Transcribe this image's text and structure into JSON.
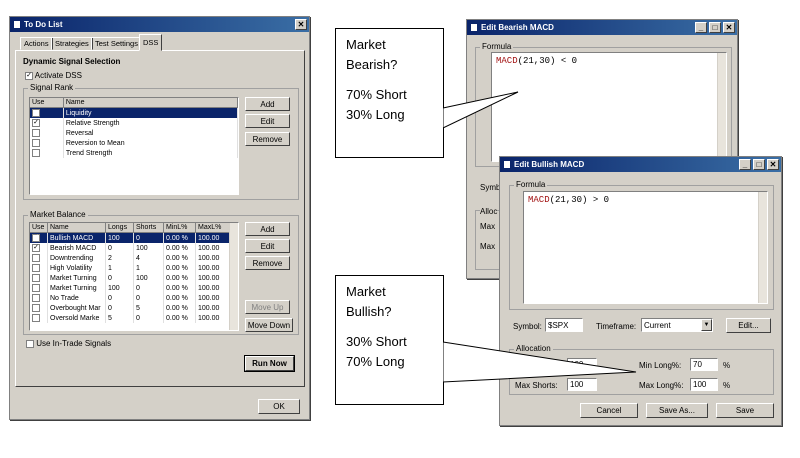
{
  "todo": {
    "title": "To Do List",
    "close_glyph": "✕",
    "tabs": [
      "Actions",
      "Strategies",
      "Test Settings",
      "DSS"
    ],
    "section_title": "Dynamic Signal Selection",
    "activate_label": "Activate DSS",
    "signal_rank": {
      "label": "Signal Rank",
      "headers": [
        "Use",
        "Name"
      ],
      "rows": [
        {
          "checked": false,
          "name": "Liquidity",
          "selected": true
        },
        {
          "checked": true,
          "name": "Relative Strength",
          "selected": false
        },
        {
          "checked": false,
          "name": "Reversal",
          "selected": false
        },
        {
          "checked": false,
          "name": "Reversion to Mean",
          "selected": false
        },
        {
          "checked": false,
          "name": "Trend Strength",
          "selected": false
        }
      ],
      "buttons": {
        "add": "Add",
        "edit": "Edit",
        "remove": "Remove"
      }
    },
    "market_balance": {
      "label": "Market Balance",
      "headers": [
        "Use",
        "Name",
        "Longs",
        "Shorts",
        "MinL%",
        "MaxL%"
      ],
      "rows": [
        {
          "checked": true,
          "name": "Bullish MACD",
          "longs": "100",
          "shorts": "0",
          "minl": "0.00 %",
          "maxl": "100.00",
          "selected": true
        },
        {
          "checked": true,
          "name": "Bearish MACD",
          "longs": "0",
          "shorts": "100",
          "minl": "0.00 %",
          "maxl": "100.00",
          "selected": false
        },
        {
          "checked": false,
          "name": "Downtrending",
          "longs": "2",
          "shorts": "4",
          "minl": "0.00 %",
          "maxl": "100.00",
          "selected": false
        },
        {
          "checked": false,
          "name": "High Volatility",
          "longs": "1",
          "shorts": "1",
          "minl": "0.00 %",
          "maxl": "100.00",
          "selected": false
        },
        {
          "checked": false,
          "name": "Market Turning",
          "longs": "0",
          "shorts": "100",
          "minl": "0.00 %",
          "maxl": "100.00",
          "selected": false
        },
        {
          "checked": false,
          "name": "Market Turning",
          "longs": "100",
          "shorts": "0",
          "minl": "0.00 %",
          "maxl": "100.00",
          "selected": false
        },
        {
          "checked": false,
          "name": "No Trade",
          "longs": "0",
          "shorts": "0",
          "minl": "0.00 %",
          "maxl": "100.00",
          "selected": false
        },
        {
          "checked": false,
          "name": "Overbought Mar",
          "longs": "0",
          "shorts": "5",
          "minl": "0.00 %",
          "maxl": "100.00",
          "selected": false
        },
        {
          "checked": false,
          "name": "Oversold Marke",
          "longs": "5",
          "shorts": "0",
          "minl": "0.00 %",
          "maxl": "100.00",
          "selected": false
        }
      ],
      "buttons": {
        "add": "Add",
        "edit": "Edit",
        "remove": "Remove",
        "move_up": "Move Up",
        "move_down": "Move Down"
      }
    },
    "in_trade_label": "Use In-Trade Signals",
    "run_now": "Run Now",
    "ok": "OK"
  },
  "bearish": {
    "title": "Edit Bearish MACD",
    "formula_label": "Formula",
    "formula_kw": "MACD",
    "formula_rest": "(21,30) < 0",
    "symbol_partial": "Symb",
    "alloc_partial": "Alloc",
    "max_partial_1": "Max",
    "max_partial_2": "Max"
  },
  "bullish": {
    "title": "Edit Bullish MACD",
    "formula_label": "Formula",
    "formula_kw": "MACD",
    "formula_rest": "(21,30) > 0",
    "symbol_label": "Symbol:",
    "symbol_value": "$SPX",
    "timeframe_label": "Timeframe:",
    "timeframe_value": "Current",
    "edit_button": "Edit...",
    "allocation_label": "Allocation",
    "max_longs_value": "100",
    "max_shorts_label": "Max Shorts:",
    "max_shorts_value": "100",
    "min_long_label": "Min Long%:",
    "min_long_value": "70",
    "max_long_label": "Max Long%:",
    "max_long_value": "100",
    "pct": "%",
    "cancel": "Cancel",
    "save_as": "Save As...",
    "save": "Save"
  },
  "callouts": {
    "bearish": [
      "Market",
      "Bearish?",
      "",
      "70% Short",
      "30% Long"
    ],
    "bullish": [
      "Market",
      "Bullish?",
      "",
      "30% Short",
      "70% Long"
    ]
  }
}
